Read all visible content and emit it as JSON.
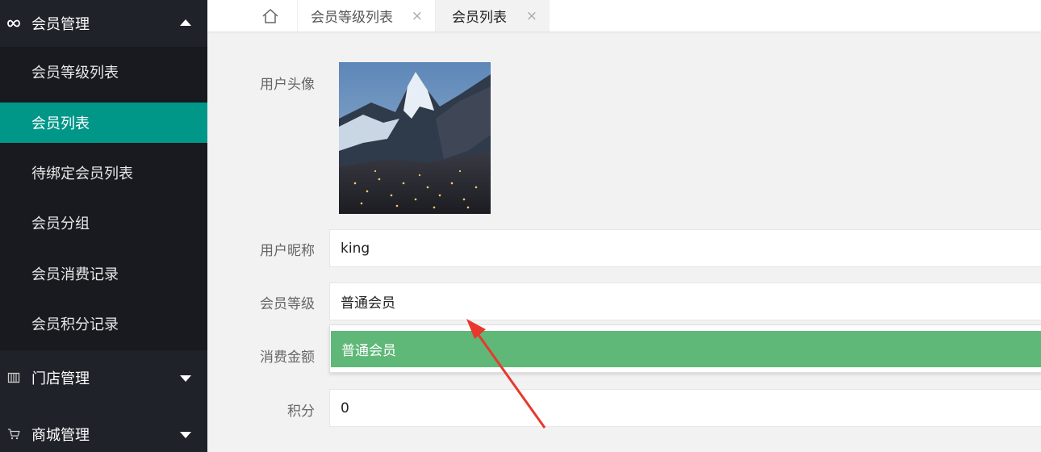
{
  "sidebar": {
    "member_group": {
      "label": "会员管理",
      "icon": "infinity-icon",
      "items": [
        {
          "label": "会员等级列表"
        },
        {
          "label": "会员列表"
        },
        {
          "label": "待绑定会员列表"
        },
        {
          "label": "会员分组"
        },
        {
          "label": "会员消费记录"
        },
        {
          "label": "会员积分记录"
        }
      ],
      "active_index": 1
    },
    "store_group": {
      "label": "门店管理",
      "icon": "store-icon"
    },
    "mall_group": {
      "label": "商城管理",
      "icon": "cart-icon"
    }
  },
  "tabs": {
    "home_icon": "home-icon",
    "items": [
      {
        "label": "会员等级列表",
        "close": "×"
      },
      {
        "label": "会员列表",
        "close": "×"
      }
    ]
  },
  "form": {
    "avatar_label": "用户头像",
    "nickname_label": "用户昵称",
    "nickname_value": "king",
    "level_label": "会员等级",
    "level_value": "普通会员",
    "level_options": [
      "普通会员"
    ],
    "amount_label": "消费金额",
    "points_label": "积分",
    "points_value": "0"
  },
  "colors": {
    "sidebar_bg": "#20222a",
    "submenu_bg": "#181a20",
    "active_item": "#009688",
    "dropdown_selected": "#5fb878",
    "annotation_arrow": "#e8382e"
  }
}
